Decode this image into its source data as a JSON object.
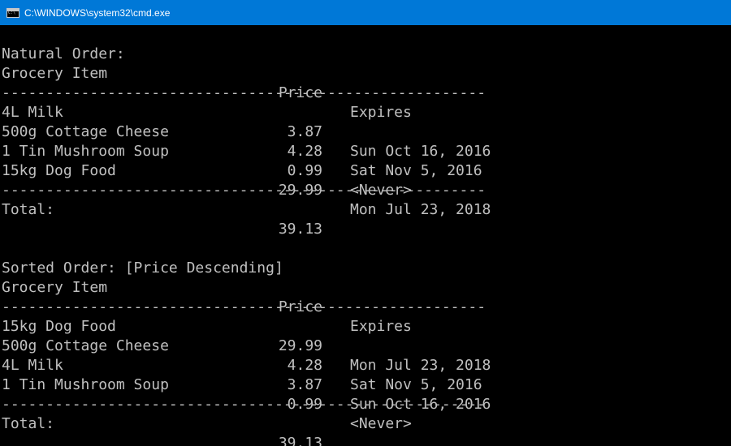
{
  "window": {
    "title": "C:\\WINDOWS\\system32\\cmd.exe"
  },
  "sections": [
    {
      "heading": "Natural Order:",
      "header": {
        "item": "Grocery Item",
        "price": "Price",
        "expires": "Expires"
      },
      "rule": "-------------------------------------------------------",
      "rows": [
        {
          "item": "4L Milk",
          "price": "3.87",
          "expires": "Sun Oct 16, 2016"
        },
        {
          "item": "500g Cottage Cheese",
          "price": "4.28",
          "expires": "Sat Nov 5, 2016"
        },
        {
          "item": "1 Tin Mushroom Soup",
          "price": "0.99",
          "expires": "<Never>"
        },
        {
          "item": "15kg Dog Food",
          "price": "29.99",
          "expires": "Mon Jul 23, 2018"
        }
      ],
      "total_label": "Total:",
      "total_value": "39.13"
    },
    {
      "heading": "Sorted Order: [Price Descending]",
      "header": {
        "item": "Grocery Item",
        "price": "Price",
        "expires": "Expires"
      },
      "rule": "-------------------------------------------------------",
      "rows": [
        {
          "item": "15kg Dog Food",
          "price": "29.99",
          "expires": "Mon Jul 23, 2018"
        },
        {
          "item": "500g Cottage Cheese",
          "price": "4.28",
          "expires": "Sat Nov 5, 2016"
        },
        {
          "item": "4L Milk",
          "price": "3.87",
          "expires": "Sun Oct 16, 2016"
        },
        {
          "item": "1 Tin Mushroom Soup",
          "price": "0.99",
          "expires": "<Never>"
        }
      ],
      "total_label": "Total:",
      "total_value": "39.13"
    }
  ],
  "colors": {
    "titlebar": "#0078d7",
    "console_bg": "#000000",
    "console_text": "#c0c0c0"
  },
  "icons": {
    "window_icon": "cmd-console-icon"
  }
}
